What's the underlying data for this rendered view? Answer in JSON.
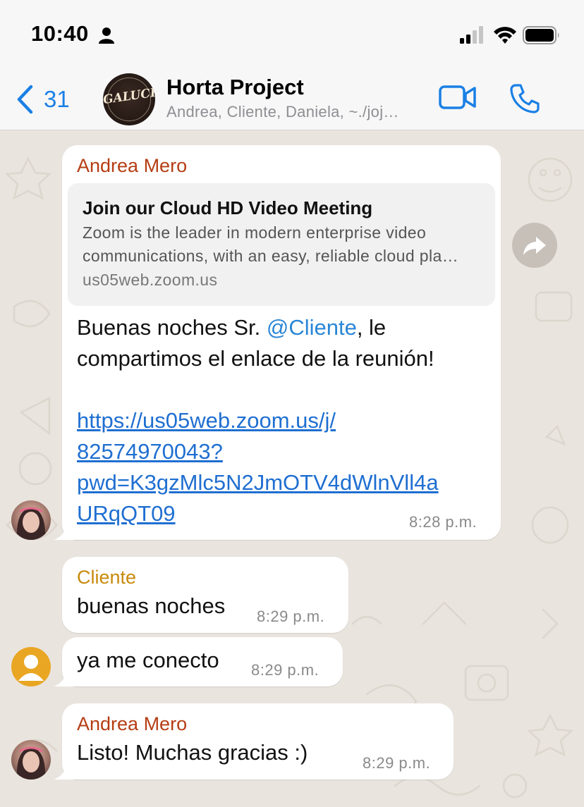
{
  "status_bar": {
    "time": "10:40"
  },
  "header": {
    "back_count": "31",
    "group_logo_text": "GALUCHI",
    "title": "Horta Project",
    "subtitle": "Andrea, Cliente, Daniela, ~./joj…"
  },
  "colors": {
    "accent": "#1a80e5",
    "andrea": "#b53d13",
    "cliente": "#c88a0c",
    "link": "#1f6fd1"
  },
  "messages": [
    {
      "sender": "Andrea Mero",
      "link_preview": {
        "title": "Join our Cloud HD Video Meeting",
        "desc_line1": "Zoom is the leader in modern enterprise video",
        "desc_line2": "communications, with an easy, reliable cloud pla…",
        "domain": "us05web.zoom.us"
      },
      "text_part1": "Buenas noches Sr. ",
      "mention": "@Cliente",
      "text_part2": ", le",
      "text_line2": "compartimos el enlace de la reunión!",
      "link_lines": [
        "https://us05web.zoom.us/j/",
        "82574970043?",
        "pwd=K3gzMlc5N2JmOTV4dWlnVll4a",
        "URqQT09"
      ],
      "time": "8:28 p.m."
    },
    {
      "sender": "Cliente",
      "text": "buenas noches",
      "time": "8:29 p.m."
    },
    {
      "text": "ya me conecto",
      "time": "8:29 p.m."
    },
    {
      "sender": "Andrea Mero",
      "text": "Listo! Muchas gracias :)",
      "time": "8:29 p.m."
    }
  ]
}
